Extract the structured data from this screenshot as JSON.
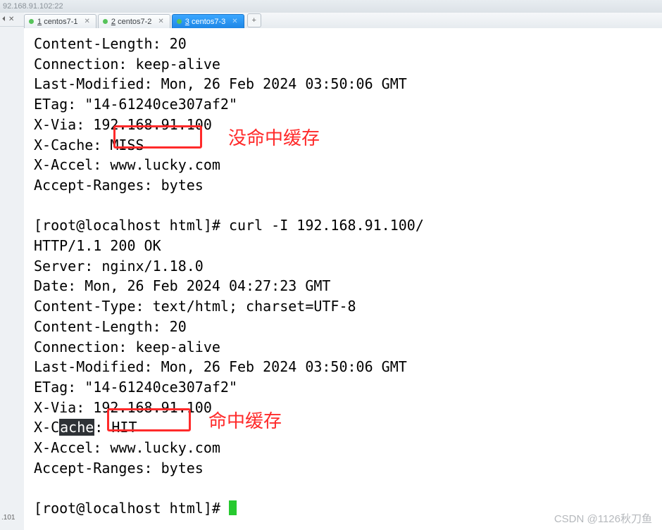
{
  "window": {
    "title": "92.168.91.102:22"
  },
  "sidebar": {
    "pin_icon": "⏴",
    "close_icon": "✕",
    "bottom_label": ".101"
  },
  "tabs": {
    "items": [
      {
        "number": "1",
        "label": "centos7-1"
      },
      {
        "number": "2",
        "label": "centos7-2"
      },
      {
        "number": "3",
        "label": "centos7-3"
      }
    ],
    "add_label": "+"
  },
  "terminal": {
    "block1": {
      "l1": "Content-Length: 20",
      "l2": "Connection: keep-alive",
      "l3": "Last-Modified: Mon, 26 Feb 2024 03:50:06 GMT",
      "l4": "ETag: \"14-61240ce307af2\"",
      "l5": "X-Via: 192.168.91.100",
      "l6": "X-Cache: MISS",
      "l7": "X-Accel: www.lucky.com",
      "l8": "Accept-Ranges: bytes"
    },
    "cmd1": "[root@localhost html]# curl -I 192.168.91.100/",
    "block2": {
      "l1": "HTTP/1.1 200 OK",
      "l2": "Server: nginx/1.18.0",
      "l3": "Date: Mon, 26 Feb 2024 04:27:23 GMT",
      "l4": "Content-Type: text/html; charset=UTF-8",
      "l5": "Content-Length: 20",
      "l6": "Connection: keep-alive",
      "l7": "Last-Modified: Mon, 26 Feb 2024 03:50:06 GMT",
      "l8": "ETag: \"14-61240ce307af2\"",
      "l9": "X-Via: 192.168.91.100",
      "l10_pre": "X-C",
      "l10_hl": "ache",
      "l10_post": ": HIT",
      "l11": "X-Accel: www.lucky.com",
      "l12": "Accept-Ranges: bytes"
    },
    "cmd2": "[root@localhost html]# "
  },
  "annotations": {
    "miss_label": "没命中缓存",
    "hit_label": "命中缓存"
  },
  "watermark": "CSDN @1126秋刀鱼"
}
